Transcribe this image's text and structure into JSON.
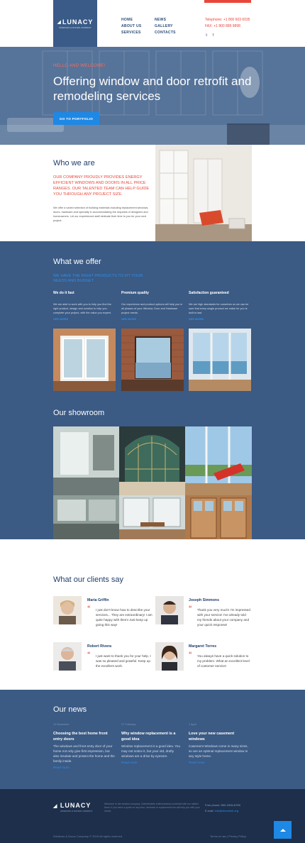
{
  "brand": {
    "name": "LUNACY",
    "tagline": "WINDOWS & DOORS COMPANY"
  },
  "nav": {
    "col1": [
      "HOME",
      "ABOUT US",
      "SERVICES"
    ],
    "col2": [
      "NEWS",
      "GALLERY",
      "CONTACTS"
    ]
  },
  "header_contact": {
    "phone": "Telephone: +1 800 603 6035",
    "fax": "FAX: +1 800 889 9898"
  },
  "social": [
    "twitter-icon",
    "facebook-icon"
  ],
  "hero": {
    "greeting": "HELLO AND WELCOME!",
    "title": "Offering window and door retrofit and remodeling services",
    "button": "GO TO PORTFOLIO"
  },
  "who": {
    "title": "Who we are",
    "lead": "OUR COMPANY PROUDLY PROVIDES ENERGY EFFICIENT WINDOWS AND DOORS IN ALL PRICE RANGES. OUR TALENTED TEAM CAN HELP GUIDE YOU THROUGH ANY PROJECT SIZE.",
    "body": "We offer a varied selection of building materials including replacement windows, doors, hardware and specialty in accommodating the requests of designers and homeowners. Let our experienced staff dedicate their time to you for your next project."
  },
  "offer": {
    "title": "What we offer",
    "lead": "WE HAVE THE RIGHT PRODUCTS TO FIT YOUR NEEDS AND BUDGET",
    "columns": [
      {
        "title": "We do it fast",
        "text": "We are able to work with you to help you find the right product, design and solution to help you complete your project, with the value you expect.",
        "more": "SEE MORE"
      },
      {
        "title": "Premium quality",
        "text": "Our experience and product options will help you in all phases of your Window, Door and Hardware project needs.",
        "more": "SEE MORE"
      },
      {
        "title": "Satisfaction guaranteed",
        "text": "We are high standards for ourselves so we can be sure that every single product we make for you is built to last.",
        "more": "SEE MORE"
      }
    ]
  },
  "showroom": {
    "title": "Our showroom"
  },
  "clients": {
    "title": "What our clients say",
    "items": [
      {
        "name": "Maria Griffin",
        "text": "I just don't know how to describe your services... They are extraordinary! I am quite happy with them! Just keep up going this way!"
      },
      {
        "name": "Joseph Simmons",
        "text": "Thank you very much! I'm impressed with your service! I've already told my friends about your company and your quick response!"
      },
      {
        "name": "Robert Rivera",
        "text": "I just want to thank you for your help. I was so pleased and grateful. Keep up the excellent work."
      },
      {
        "name": "Margaret Torres",
        "text": "You always have a quick solution to my problem. What an excellent level of customer service!"
      }
    ]
  },
  "news": {
    "title": "Our news",
    "items": [
      {
        "date": "12 November",
        "head": "Choosing the best home front entry doors",
        "text": "The windows and front entry door of your home not only give first impression, but also insulate and protect the home and the family inside.",
        "more": "Read more"
      },
      {
        "date": "27 February",
        "head": "Why window replacement is a good idea",
        "text": "Window replacement is a good idea. You may not notice it, but your old, drafty windows are a drive by eyesore.",
        "more": "Read more"
      },
      {
        "date": "1 April",
        "head": "Love your new casement windows",
        "text": "Casement Windows come in many sizes, so are an optimal replacement window in any style home.",
        "more": "Read more"
      }
    ]
  },
  "footer": {
    "about": "Welcome to the window company. Unbelievable craftsmanship combined with our skilled team. If you need a quote on any door, windows or replacement we will help you with your needs.",
    "phone": "Free phone: 800-2345-6789",
    "email_label": "E-mail:",
    "email": "info@demolink.org",
    "copyright": "Windows & Doors Company © 2016 All rights reserved.",
    "links": "Terms of use | Privacy Policy"
  }
}
